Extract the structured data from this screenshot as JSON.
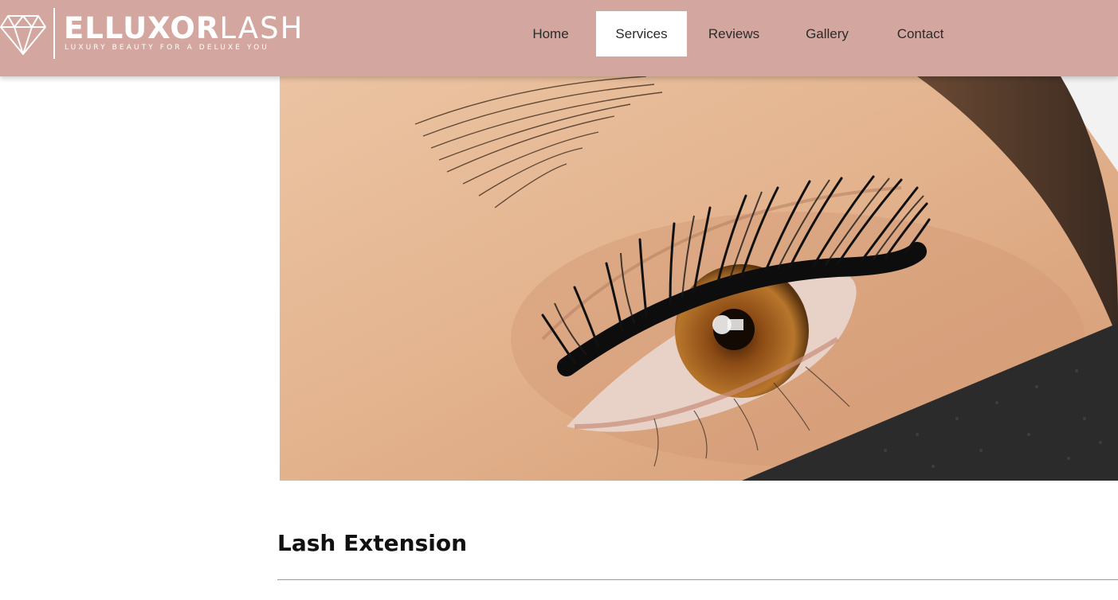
{
  "brand": {
    "name_bold": "ELLUXOR",
    "name_light": "LASH",
    "tagline": "LUXURY BEAUTY FOR A DELUXE YOU",
    "icon": "diamond-icon"
  },
  "nav": {
    "items": [
      {
        "label": "Home",
        "active": false
      },
      {
        "label": "Services",
        "active": true
      },
      {
        "label": "Reviews",
        "active": false
      },
      {
        "label": "Gallery",
        "active": false
      },
      {
        "label": "Contact",
        "active": false
      }
    ]
  },
  "hero": {
    "image": "eyelash-extension-closeup"
  },
  "service": {
    "title": "Lash Extension"
  },
  "colors": {
    "header_bg": "#d4a6a0",
    "active_tab_bg": "#ffffff",
    "text_dark": "#2b2b2b",
    "rule": "#9b9b9b"
  }
}
